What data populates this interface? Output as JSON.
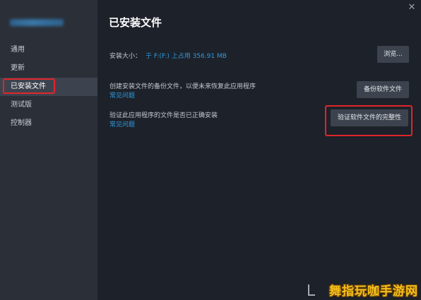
{
  "sidebar": {
    "items": [
      {
        "label": "通用",
        "active": false
      },
      {
        "label": "更新",
        "active": false
      },
      {
        "label": "已安装文件",
        "active": true
      },
      {
        "label": "测试版",
        "active": false
      },
      {
        "label": "控制器",
        "active": false
      }
    ]
  },
  "main": {
    "title": "已安装文件",
    "install_size": {
      "label": "安装大小：",
      "value": "于 F:(F:) 上占用 356.91 MB",
      "button": "浏览..."
    },
    "backup": {
      "description": "创建安装文件的备份文件，以便未来恢复此应用程序",
      "link": "常见问题",
      "button": "备份软件文件"
    },
    "verify": {
      "description": "验证此应用程序的文件是否已正确安装",
      "link": "常见问题",
      "button": "验证软件文件的完整性"
    }
  },
  "window": {
    "close_glyph": "✕"
  },
  "watermark": {
    "text": "舞指玩咖手游网"
  },
  "colors": {
    "background": "#1d2129",
    "sidebar": "#2b2f37",
    "accent_link": "#2f9be0",
    "highlight_red": "#e0252b",
    "button": "#3d434e"
  }
}
